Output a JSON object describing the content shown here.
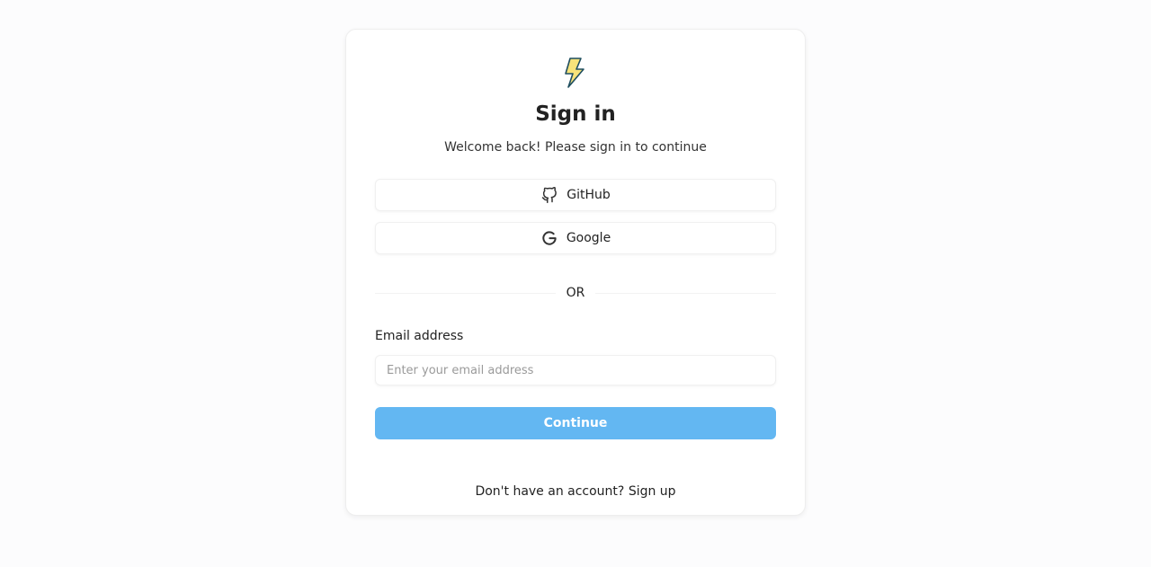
{
  "auth": {
    "logo_icon": "lightning-bolt-icon",
    "title": "Sign in",
    "subtitle": "Welcome back! Please sign in to continue",
    "social": {
      "github_label": "GitHub",
      "github_icon": "github-icon",
      "google_label": "Google",
      "google_icon": "google-icon"
    },
    "divider_text": "OR",
    "email": {
      "label": "Email address",
      "value": "",
      "placeholder": "Enter your email address"
    },
    "continue_label": "Continue",
    "footer": {
      "prompt": "Don't have an account?",
      "link": "Sign up"
    }
  },
  "colors": {
    "accent": "#63b7f2",
    "bolt_fill": "#f7e37a",
    "bolt_stroke": "#1f4e5f",
    "text": "#222222",
    "placeholder": "#9a9a9a",
    "background": "#fcfcfd"
  }
}
